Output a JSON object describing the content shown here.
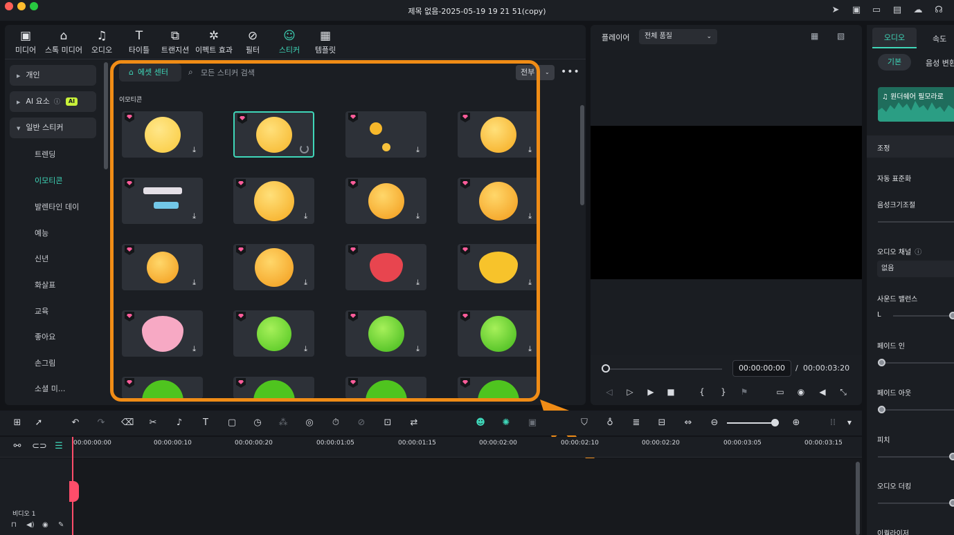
{
  "window": {
    "title": "제목 없음-2025-05-19 19 21 51(copy)"
  },
  "toolbar": {
    "tabs": [
      {
        "label": "미디어",
        "icon": "media-icon"
      },
      {
        "label": "스톡 미디어",
        "icon": "stock-media-icon"
      },
      {
        "label": "오디오",
        "icon": "music-note-icon"
      },
      {
        "label": "타이틀",
        "icon": "title-t-icon"
      },
      {
        "label": "트랜지션",
        "icon": "transition-icon"
      },
      {
        "label": "이펙트 효과",
        "icon": "effects-sparkle-icon"
      },
      {
        "label": "필터",
        "icon": "filter-icon"
      },
      {
        "label": "스티커",
        "icon": "sticker-icon"
      },
      {
        "label": "템플릿",
        "icon": "template-icon"
      }
    ],
    "active_tab": "스티커"
  },
  "sidebar": {
    "categories": [
      {
        "label": "개인"
      },
      {
        "label": "AI 요소",
        "badge": "AI"
      },
      {
        "label": "일반 스티커"
      }
    ],
    "subitems": [
      "트렌딩",
      "이모티콘",
      "발렌타인 데이",
      "예능",
      "신년",
      "화살표",
      "교육",
      "좋아요",
      "손그림",
      "소셜 미..."
    ],
    "active_subitem": "이모티콘"
  },
  "stickers": {
    "asset_center_label": "에셋 센터",
    "search_placeholder": "모든 스티커 검색",
    "filter_label": "전부",
    "section_title": "이모티콘"
  },
  "player": {
    "label": "플레이어",
    "quality": "전체 품질",
    "current_time": "00:00:00:00",
    "separator": "/",
    "total_time": "00:00:03:20"
  },
  "properties": {
    "tabs": [
      "오디오",
      "속도"
    ],
    "subtabs": [
      "기본",
      "음성 변환"
    ],
    "clip_label": "원더쉐어 필모라로",
    "adjust_label": "조정",
    "auto_normalize": "자동 표준화",
    "volume": "음성크기조절",
    "channel_label": "오디오 채널",
    "channel_value": "없음",
    "balance_label": "사운드 밸런스",
    "balance_left": "L",
    "fade_in": "페이드 인",
    "fade_out": "페이드 아웃",
    "pitch": "피치",
    "ducking": "오디오 더킹",
    "equalizer": "이퀄라이저"
  },
  "timeline": {
    "ticks": [
      "00:00:00:00",
      "00:00:00:10",
      "00:00:00:20",
      "00:00:01:05",
      "00:00:01:15",
      "00:00:02:00",
      "00:00:02:10",
      "00:00:02:20",
      "00:00:03:05",
      "00:00:03:15"
    ],
    "track_name": "비디오 1"
  },
  "colors": {
    "accent": "#3fd7b9",
    "highlight": "#f08c16",
    "playhead": "#ff4d6a"
  }
}
